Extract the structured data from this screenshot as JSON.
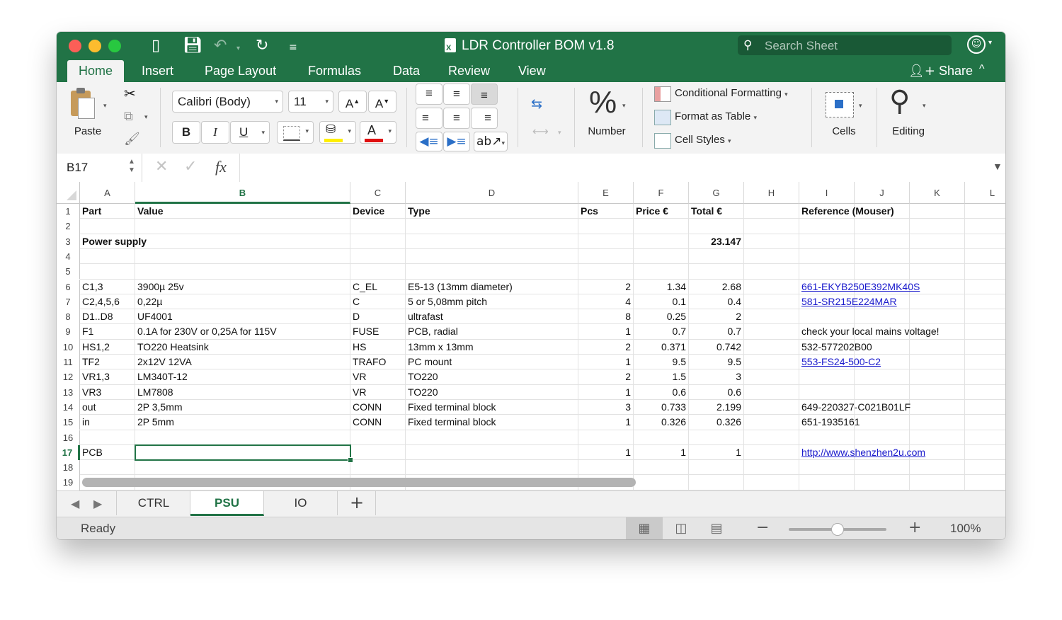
{
  "window": {
    "title": "LDR Controller BOM v1.8",
    "search_placeholder": "Search Sheet",
    "share_label": "Share"
  },
  "ribbon_tabs": [
    "Home",
    "Insert",
    "Page Layout",
    "Formulas",
    "Data",
    "Review",
    "View"
  ],
  "ribbon": {
    "paste_label": "Paste",
    "font_name": "Calibri (Body)",
    "font_size": "11",
    "bold_label": "B",
    "italic_label": "I",
    "underline_label": "U",
    "grow_font_label": "A",
    "shrink_font_label": "A",
    "font_color_label": "A",
    "number_label": "Number",
    "number_symbol": "%",
    "conditional_formatting": "Conditional Formatting",
    "format_as_table": "Format as Table",
    "cell_styles": "Cell Styles",
    "cells_label": "Cells",
    "editing_label": "Editing"
  },
  "formula_bar": {
    "name_box": "B17",
    "fx_label": "fx",
    "value": ""
  },
  "columns": [
    "A",
    "B",
    "C",
    "D",
    "E",
    "F",
    "G",
    "H",
    "I",
    "J",
    "K",
    "L"
  ],
  "selected_column": "B",
  "row_numbers": [
    "1",
    "2",
    "3",
    "4",
    "5",
    "6",
    "7",
    "8",
    "9",
    "10",
    "11",
    "12",
    "13",
    "14",
    "15",
    "16",
    "17",
    "18",
    "19"
  ],
  "selected_row": "17",
  "selected_cell": "B17",
  "rows": [
    {
      "row": 1,
      "A": "Part",
      "B": "Value",
      "C": "Device",
      "D": "Type",
      "E": "Pcs",
      "F": "Price €",
      "G": "Total €",
      "I": "Reference (Mouser)"
    },
    {
      "row": 2
    },
    {
      "row": 3,
      "A": "Power supply",
      "G": "23.147"
    },
    {
      "row": 4
    },
    {
      "row": 5
    },
    {
      "row": 6,
      "A": "C1,3",
      "B": "3900µ 25v",
      "C": "C_EL",
      "D": "E5-13 (13mm diameter)",
      "E": "2",
      "F": "1.34",
      "G": "2.68",
      "I": "661-EKYB250E392MK40S"
    },
    {
      "row": 7,
      "A": "C2,4,5,6",
      "B": "0,22µ",
      "C": "C",
      "D": "5 or 5,08mm pitch",
      "E": "4",
      "F": "0.1",
      "G": "0.4",
      "I": "581-SR215E224MAR"
    },
    {
      "row": 8,
      "A": "D1..D8",
      "B": "UF4001",
      "C": "D",
      "D": "ultrafast",
      "E": "8",
      "F": "0.25",
      "G": "2"
    },
    {
      "row": 9,
      "A": "F1",
      "B": "0.1A for 230V or 0,25A for 115V",
      "C": "FUSE",
      "D": "PCB, radial",
      "E": "1",
      "F": "0.7",
      "G": "0.7",
      "I": "check your local mains voltage!"
    },
    {
      "row": 10,
      "A": "HS1,2",
      "B": "TO220 Heatsink",
      "C": "HS",
      "D": "13mm x 13mm",
      "E": "2",
      "F": "0.371",
      "G": "0.742",
      "I": "532-577202B00"
    },
    {
      "row": 11,
      "A": "TF2",
      "B": "2x12V 12VA",
      "C": "TRAFO",
      "D": "PC mount",
      "E": "1",
      "F": "9.5",
      "G": "9.5",
      "I": "553-FS24-500-C2"
    },
    {
      "row": 12,
      "A": "VR1,3",
      "B": "LM340T-12",
      "C": "VR",
      "D": "TO220",
      "E": "2",
      "F": "1.5",
      "G": "3"
    },
    {
      "row": 13,
      "A": "VR3",
      "B": "LM7808",
      "C": "VR",
      "D": "TO220",
      "E": "1",
      "F": "0.6",
      "G": "0.6"
    },
    {
      "row": 14,
      "A": "out",
      "B": "2P 3,5mm",
      "C": "CONN",
      "D": "Fixed terminal block",
      "E": "3",
      "F": "0.733",
      "G": "2.199",
      "I": "649-220327-C021B01LF"
    },
    {
      "row": 15,
      "A": "in",
      "B": "2P 5mm",
      "C": "CONN",
      "D": "Fixed terminal block",
      "E": "1",
      "F": "0.326",
      "G": "0.326",
      "I": "651-1935161"
    },
    {
      "row": 16
    },
    {
      "row": 17,
      "A": "PCB",
      "E": "1",
      "F": "1",
      "G": "1",
      "I": "http://www.shenzhen2u.com"
    },
    {
      "row": 18
    },
    {
      "row": 19
    }
  ],
  "bold_rows": [
    1,
    3
  ],
  "link_cells": [
    "I6",
    "I7",
    "I11",
    "I17"
  ],
  "sheets": [
    "CTRL",
    "PSU",
    "IO"
  ],
  "active_sheet": "PSU",
  "status": {
    "ready": "Ready",
    "zoom": "100%",
    "zoom_level_percent": 100
  },
  "colors": {
    "accent": "#217346",
    "link": "#1a1acc"
  }
}
